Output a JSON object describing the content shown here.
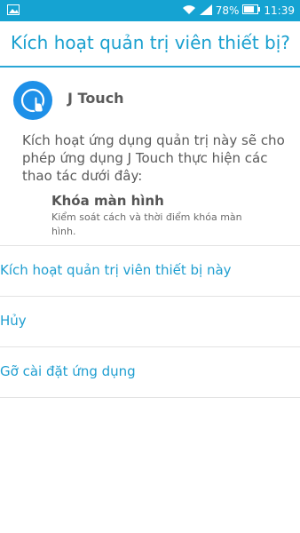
{
  "status_bar": {
    "battery_percent": "78%",
    "time": "11:39",
    "icons": [
      "gallery-icon",
      "wifi-icon",
      "signal-icon",
      "battery-icon"
    ]
  },
  "dialog": {
    "title": "Kích hoạt quản trị viên thiết bị?",
    "app": {
      "name": "J Touch",
      "icon": "touch-icon"
    },
    "description": "Kích hoạt ứng dụng quản trị này sẽ cho phép ứng dụng J Touch thực hiện các thao tác dưới đây:",
    "policy": {
      "title": "Khóa màn hình",
      "description": "Kiểm soát cách và thời điểm khóa màn hình."
    }
  },
  "actions": {
    "activate": "Kích hoạt quản trị viên thiết bị này",
    "cancel": "Hủy",
    "uninstall": "Gỡ cài đặt ứng dụng"
  },
  "colors": {
    "status_bar": "#15a3d2",
    "accent": "#1aa0cf",
    "app_icon": "#1e90e8"
  }
}
